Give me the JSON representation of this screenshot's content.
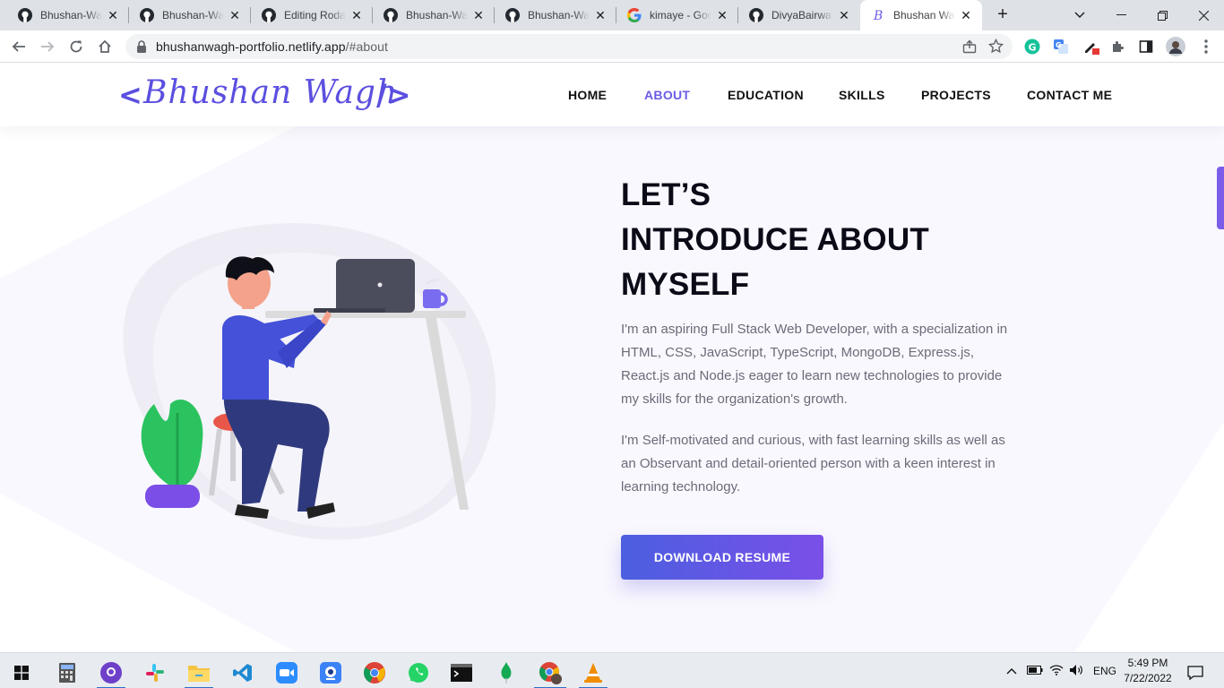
{
  "browser": {
    "tabs": [
      {
        "title": "Bhushan-Wagh/",
        "icon": "github-icon",
        "active": false
      },
      {
        "title": "Bhushan-Wagh/",
        "icon": "github-icon",
        "active": false
      },
      {
        "title": "Editing Rodan",
        "icon": "github-icon",
        "active": false
      },
      {
        "title": "Bhushan-Wagh/",
        "icon": "github-icon",
        "active": false
      },
      {
        "title": "Bhushan-Wagh/",
        "icon": "github-icon",
        "active": false
      },
      {
        "title": "kimaye - Goo",
        "icon": "google-icon",
        "active": false
      },
      {
        "title": "DivyaBairwa (",
        "icon": "github-icon",
        "active": false
      },
      {
        "title": "Bhushan Wagh",
        "icon": "portfolio-b-icon",
        "active": true
      }
    ],
    "url_host": "bhushanwagh-portfolio.netlify.app",
    "url_path": "/#about"
  },
  "site": {
    "logo": {
      "open": "<",
      "name": "Bhushan Wagh",
      "close": "/>"
    },
    "nav": [
      {
        "label": "HOME",
        "active": false
      },
      {
        "label": "ABOUT",
        "active": true
      },
      {
        "label": "EDUCATION",
        "active": false
      },
      {
        "label": "SKILLS",
        "active": false
      },
      {
        "label": "PROJECTS",
        "active": false
      },
      {
        "label": "CONTACT ME",
        "active": false
      }
    ],
    "about": {
      "heading_lines": [
        "LET’S",
        "INTRODUCE ABOUT",
        "MYSELF"
      ],
      "paragraph_1": "I'm an aspiring Full Stack Web Developer, with a specialization in HTML, CSS, JavaScript, TypeScript, MongoDB, Express.js, React.js and Node.js eager to learn new technologies to provide my skills for the organization's growth.",
      "paragraph_2": "I'm Self-motivated and curious, with fast learning skills as well as an Observant and detail-oriented person with a keen interest in learning technology.",
      "button_label": "DOWNLOAD RESUME"
    }
  },
  "taskbar": {
    "apps": [
      "calculator-icon",
      "github-desktop-icon",
      "slack-icon",
      "file-explorer-icon",
      "vscode-icon",
      "zoom-icon",
      "webcam-icon",
      "chrome-icon",
      "whatsapp-icon",
      "terminal-icon",
      "mongodb-compass-icon",
      "chrome-profile-icon",
      "vlc-icon"
    ],
    "language": "ENG",
    "time": "5:49 PM",
    "date": "7/22/2022"
  },
  "colors": {
    "accent": "#6b5ce7",
    "button_gradient_start": "#4b5fe0",
    "button_gradient_end": "#7a4fe8",
    "heading": "#0b0b18",
    "body_text": "#6b6b7a"
  }
}
